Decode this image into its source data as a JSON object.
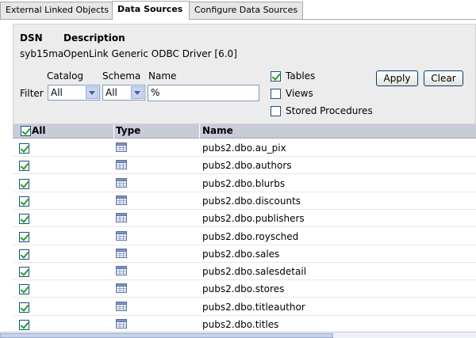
{
  "tabs": [
    {
      "label": "External Linked Objects",
      "active": false
    },
    {
      "label": "Data Sources",
      "active": true
    },
    {
      "label": "Configure Data Sources",
      "active": false
    }
  ],
  "dsn": {
    "dsn_header": "DSN",
    "description_header": "Description",
    "dsn_value": "syb15ma",
    "description_value": "OpenLink Generic ODBC Driver [6.0]"
  },
  "filter": {
    "filter_label": "Filter",
    "catalog_label": "Catalog",
    "catalog_value": "All",
    "schema_label": "Schema",
    "schema_value": "All",
    "name_label": "Name",
    "name_value": "%"
  },
  "object_types": [
    {
      "label": "Tables",
      "checked": true
    },
    {
      "label": "Views",
      "checked": false
    },
    {
      "label": "Stored Procedures",
      "checked": false
    }
  ],
  "buttons": {
    "apply_label": "Apply",
    "clear_label": "Clear"
  },
  "table": {
    "columns": {
      "all": "All",
      "type": "Type",
      "name": "Name"
    },
    "all_checked": true,
    "rows": [
      {
        "checked": true,
        "type_icon": "table-icon",
        "name": "pubs2.dbo.au_pix"
      },
      {
        "checked": true,
        "type_icon": "table-icon",
        "name": "pubs2.dbo.authors"
      },
      {
        "checked": true,
        "type_icon": "table-icon",
        "name": "pubs2.dbo.blurbs"
      },
      {
        "checked": true,
        "type_icon": "table-icon",
        "name": "pubs2.dbo.discounts"
      },
      {
        "checked": true,
        "type_icon": "table-icon",
        "name": "pubs2.dbo.publishers"
      },
      {
        "checked": true,
        "type_icon": "table-icon",
        "name": "pubs2.dbo.roysched"
      },
      {
        "checked": true,
        "type_icon": "table-icon",
        "name": "pubs2.dbo.sales"
      },
      {
        "checked": true,
        "type_icon": "table-icon",
        "name": "pubs2.dbo.salesdetail"
      },
      {
        "checked": true,
        "type_icon": "table-icon",
        "name": "pubs2.dbo.stores"
      },
      {
        "checked": true,
        "type_icon": "table-icon",
        "name": "pubs2.dbo.titleauthor"
      },
      {
        "checked": true,
        "type_icon": "table-icon",
        "name": "pubs2.dbo.titles"
      }
    ]
  },
  "colors": {
    "header_bg": "#c8ccd8",
    "panel_bg": "#ececec",
    "check_green": "#21a121"
  }
}
